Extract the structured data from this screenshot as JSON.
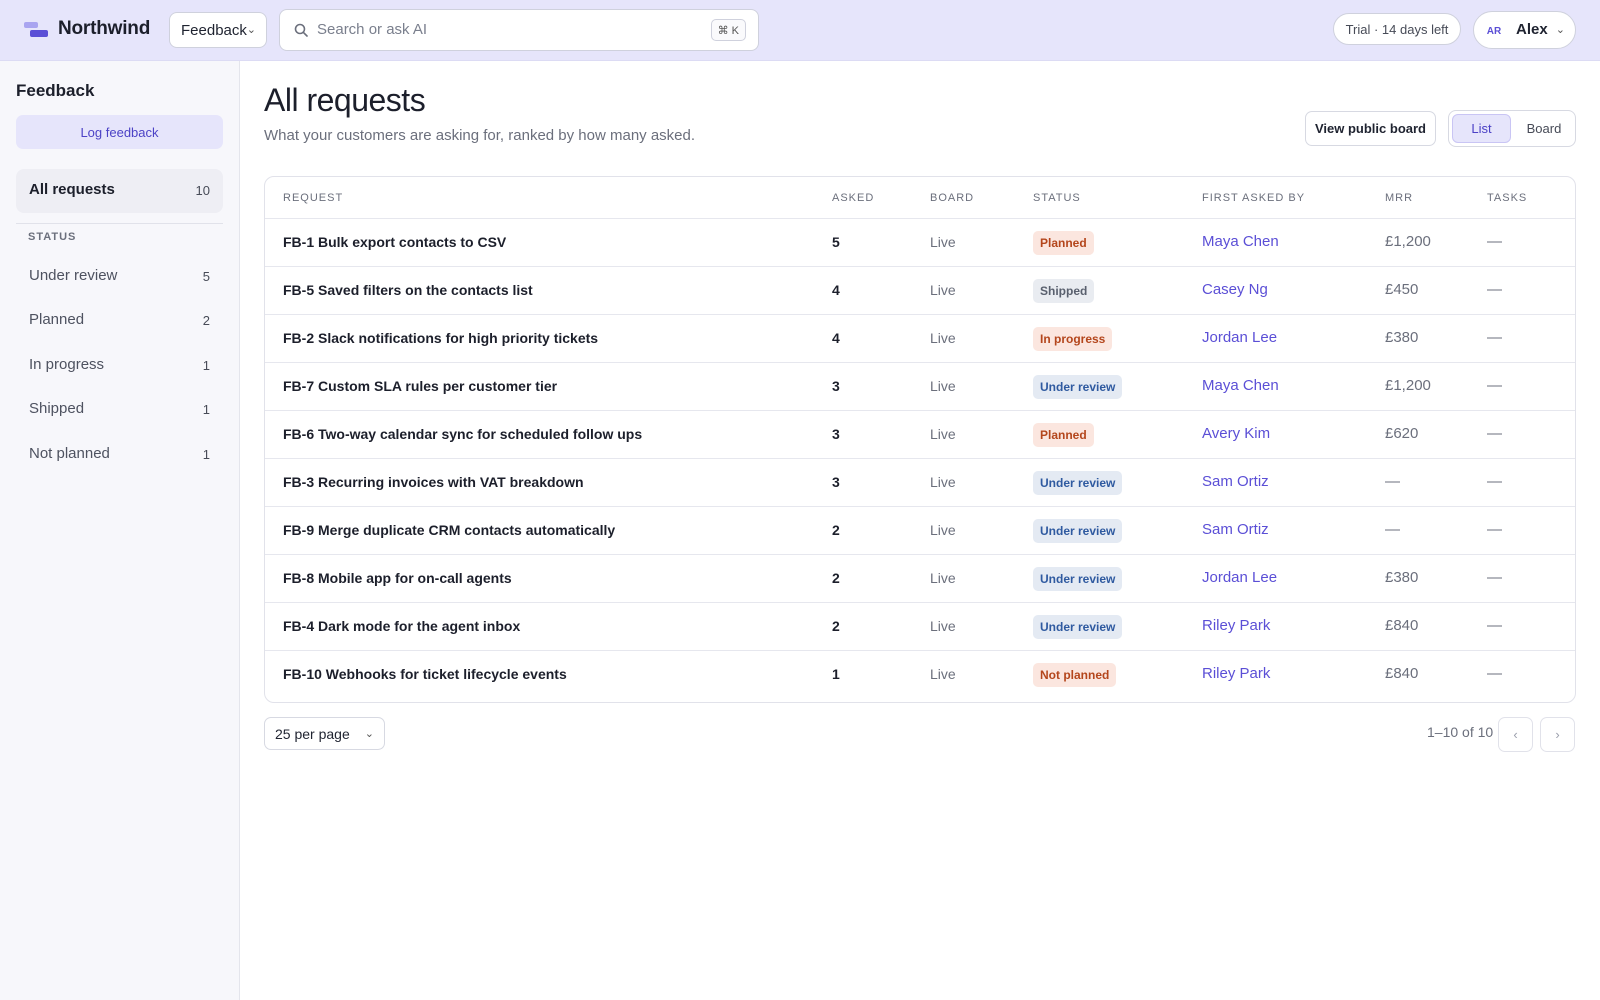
{
  "app": {
    "name": "Northwind",
    "workspace": "Feedback"
  },
  "search": {
    "placeholder": "Search or ask AI",
    "shortcut": "⌘ K"
  },
  "trial": {
    "label": "Trial · 14 days left"
  },
  "user": {
    "initials": "AR",
    "name": "Alex"
  },
  "sidebar": {
    "title": "Feedback",
    "log_button": "Log feedback",
    "all": {
      "label": "All requests",
      "count": "10"
    },
    "section_label": "STATUS",
    "items": [
      {
        "label": "Under review",
        "count": "5"
      },
      {
        "label": "Planned",
        "count": "2"
      },
      {
        "label": "In progress",
        "count": "1"
      },
      {
        "label": "Shipped",
        "count": "1"
      },
      {
        "label": "Not planned",
        "count": "1"
      }
    ]
  },
  "main": {
    "title": "All requests",
    "subtitle": "What your customers are asking for, ranked by how many asked.",
    "public_board_button": "View public board",
    "view_toggle": {
      "list": "List",
      "board": "Board",
      "selected": "List"
    }
  },
  "table": {
    "headers": {
      "request": "REQUEST",
      "asked": "ASKED",
      "board": "BOARD",
      "status": "STATUS",
      "first_asked_by": "FIRST ASKED BY",
      "mrr": "MRR",
      "tasks": "TASKS"
    },
    "rows": [
      {
        "request": "FB-1 Bulk export contacts to CSV",
        "asked": "5",
        "board": "Live",
        "status": "Planned",
        "first": "Maya Chen",
        "mrr": "£1,200",
        "tasks": "—"
      },
      {
        "request": "FB-5 Saved filters on the contacts list",
        "asked": "4",
        "board": "Live",
        "status": "Shipped",
        "first": "Casey Ng",
        "mrr": "£450",
        "tasks": "—"
      },
      {
        "request": "FB-2 Slack notifications for high priority tickets",
        "asked": "4",
        "board": "Live",
        "status": "In progress",
        "first": "Jordan Lee",
        "mrr": "£380",
        "tasks": "—"
      },
      {
        "request": "FB-7 Custom SLA rules per customer tier",
        "asked": "3",
        "board": "Live",
        "status": "Under review",
        "first": "Maya Chen",
        "mrr": "£1,200",
        "tasks": "—"
      },
      {
        "request": "FB-6 Two-way calendar sync for scheduled follow ups",
        "asked": "3",
        "board": "Live",
        "status": "Planned",
        "first": "Avery Kim",
        "mrr": "£620",
        "tasks": "—"
      },
      {
        "request": "FB-3 Recurring invoices with VAT breakdown",
        "asked": "3",
        "board": "Live",
        "status": "Under review",
        "first": "Sam Ortiz",
        "mrr": "—",
        "tasks": "—"
      },
      {
        "request": "FB-9 Merge duplicate CRM contacts automatically",
        "asked": "2",
        "board": "Live",
        "status": "Under review",
        "first": "Sam Ortiz",
        "mrr": "—",
        "tasks": "—"
      },
      {
        "request": "FB-8 Mobile app for on-call agents",
        "asked": "2",
        "board": "Live",
        "status": "Under review",
        "first": "Jordan Lee",
        "mrr": "£380",
        "tasks": "—"
      },
      {
        "request": "FB-4 Dark mode for the agent inbox",
        "asked": "2",
        "board": "Live",
        "status": "Under review",
        "first": "Riley Park",
        "mrr": "£840",
        "tasks": "—"
      },
      {
        "request": "FB-10 Webhooks for ticket lifecycle events",
        "asked": "1",
        "board": "Live",
        "status": "Not planned",
        "first": "Riley Park",
        "mrr": "£840",
        "tasks": "—"
      }
    ]
  },
  "pagination": {
    "per_page": "25 per page",
    "range": "1–10 of 10",
    "prev": "‹",
    "next": "›"
  },
  "colors": {
    "accent": "#5b4fd6",
    "topbar_bg": "#e6e5fb",
    "sidebar_bg": "#f7f7fb"
  }
}
